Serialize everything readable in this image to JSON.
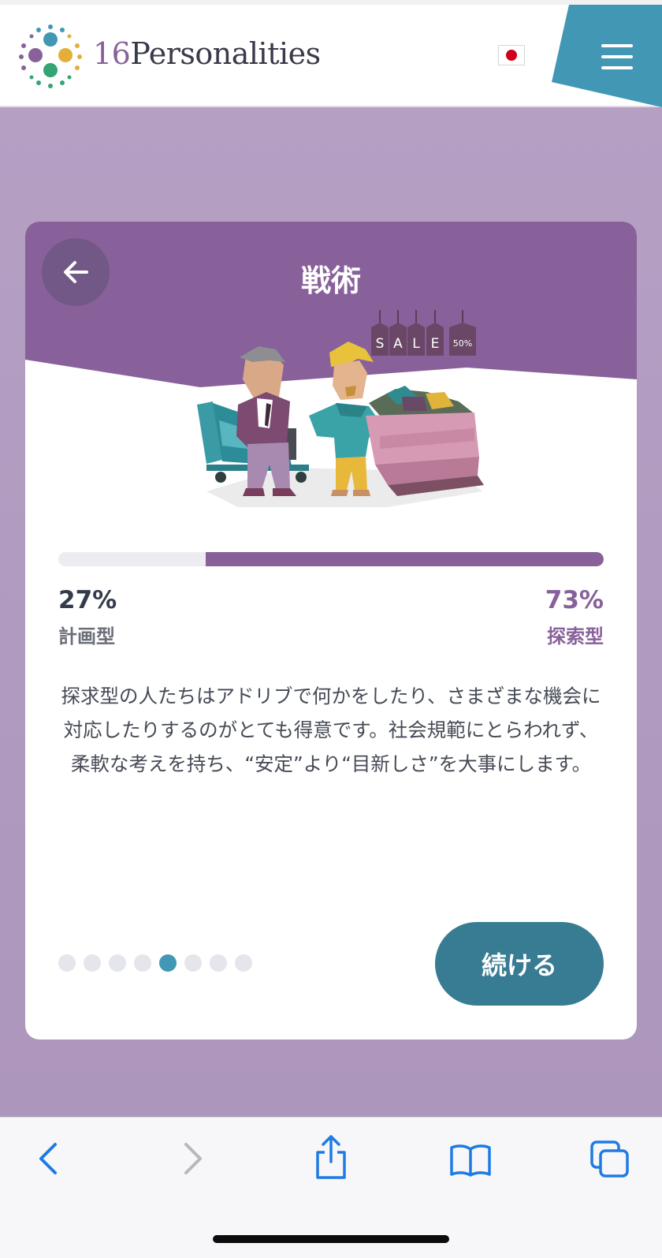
{
  "header": {
    "brand_number": "16",
    "brand_text": "Personalities",
    "language_flag": "japan-flag-icon",
    "menu_icon": "hamburger-menu-icon"
  },
  "card": {
    "back_icon": "arrow-left-icon",
    "title": "戦術",
    "illustration_sign": "SALE",
    "illustration_tag": "50%",
    "progress": {
      "left_percent": "27%",
      "left_label": "計画型",
      "right_percent": "73%",
      "right_label": "探索型",
      "right_fraction": 0.73
    },
    "description": "探求型の人たちはアドリブで何かをしたり、さまざまな機会に対応したりするのがとても得意です。社会規範にとらわれず、柔軟な考えを持ち、“安定”より“目新しさ”を大事にします。",
    "pager": {
      "total": 8,
      "active_index": 4
    },
    "continue_label": "続ける"
  },
  "browser_toolbar": {
    "items": [
      "back-icon",
      "forward-icon",
      "share-icon",
      "bookmarks-icon",
      "tabs-icon"
    ]
  },
  "colors": {
    "accent_purple": "#88619a",
    "teal_button": "#387c93",
    "active_dot": "#4298b4",
    "page_background": "#b59fc3",
    "ios_blue": "#1e7be4"
  }
}
